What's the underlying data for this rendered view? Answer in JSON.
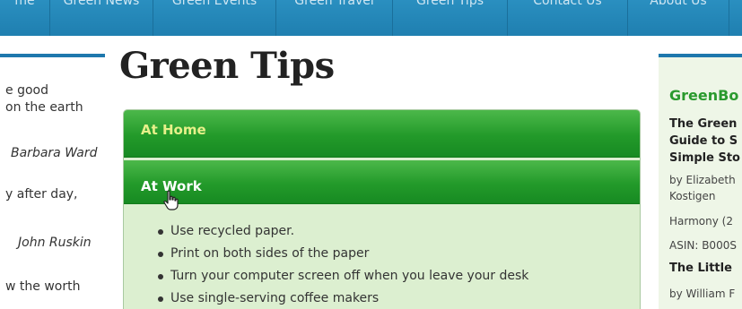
{
  "nav": {
    "items": [
      "me",
      "Green News",
      "Green Events",
      "Green Travel",
      "Green Tips",
      "Contact Us",
      "About Us",
      ""
    ]
  },
  "left": {
    "q1_line1": "e good",
    "q1_line2": "on the earth",
    "q1_author": "Barbara Ward",
    "q2_line1": "y after day,",
    "q2_author": "John Ruskin",
    "q3_line1": "w the worth"
  },
  "main": {
    "title": "Green Tips",
    "sections": [
      {
        "label": "At Home"
      },
      {
        "label": "At Work"
      }
    ],
    "tips": [
      "Use recycled paper.",
      "Print on both sides of the paper",
      "Turn your computer screen off when you leave your desk",
      "Use single-serving coffee makers"
    ]
  },
  "sidebar": {
    "heading": "GreenBo",
    "book1_line1": "The Green",
    "book1_line2": "Guide to S",
    "book1_line3": "Simple Sto",
    "book1_by1": "by Elizabeth",
    "book1_by2": "Kostigen",
    "book1_pub": "Harmony (2",
    "book1_asin": "ASIN: B000S",
    "book2_title": "The Little",
    "book2_by": "by William F"
  },
  "colors": {
    "nav": "#1f7fb0",
    "accordion_header": "#239a2a",
    "accordion_body": "#dcefd0",
    "sidebar_heading": "#2a9a2e"
  }
}
